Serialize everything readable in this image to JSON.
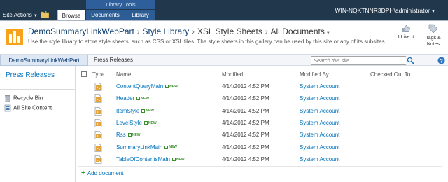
{
  "ribbon": {
    "site_actions": "Site Actions",
    "contextual_group": "Library Tools",
    "tabs": [
      {
        "label": "Browse"
      },
      {
        "label": "Documents"
      },
      {
        "label": "Library"
      }
    ],
    "user": "WIN-NQKTNNR3DPH\\administrator"
  },
  "title_area": {
    "breadcrumb": [
      "DemoSummaryLinkWebPart",
      "Style Library",
      "XSL Style Sheets",
      "All Documents"
    ],
    "description": "Use the style library to store style sheets, such as CSS or XSL files. The style sheets in this gallery can be used by this site or any of its subsites.",
    "i_like_it": "I Like It",
    "tags_notes": [
      "Tags &",
      "Notes"
    ]
  },
  "top_nav": {
    "items": [
      "DemoSummaryLinkWebPart",
      "Press Releases"
    ],
    "search_placeholder": "Search this site..."
  },
  "quick_launch": {
    "heading": "Press Releases",
    "recycle_bin": "Recycle Bin",
    "all_site_content": "All Site Content"
  },
  "list": {
    "columns": [
      "Type",
      "Name",
      "Modified",
      "Modified By",
      "Checked Out To"
    ],
    "rows": [
      {
        "name": "ContentQueryMain",
        "new": "NEW",
        "modified": "4/14/2012 4:52 PM",
        "modified_by": "System Account"
      },
      {
        "name": "Header",
        "new": "NEW",
        "modified": "4/14/2012 4:52 PM",
        "modified_by": "System Account"
      },
      {
        "name": "ItemStyle",
        "new": "NEW",
        "modified": "4/14/2012 4:52 PM",
        "modified_by": "System Account"
      },
      {
        "name": "LevelStyle",
        "new": "NEW",
        "modified": "4/14/2012 4:52 PM",
        "modified_by": "System Account"
      },
      {
        "name": "Rss",
        "new": "NEW",
        "modified": "4/14/2012 4:52 PM",
        "modified_by": "System Account"
      },
      {
        "name": "SummaryLinkMain",
        "new": "NEW",
        "modified": "4/14/2012 4:52 PM",
        "modified_by": "System Account"
      },
      {
        "name": "TableOfContentsMain",
        "new": "NEW",
        "modified": "4/14/2012 4:52 PM",
        "modified_by": "System Account"
      }
    ],
    "add_document": "Add document"
  },
  "colors": {
    "ribbon_bg": "#21374c",
    "contextual_tab": "#2d5d95",
    "link": "#0072bc",
    "new_badge": "#3a8f2a"
  },
  "icons": [
    "folder-nav-icon",
    "site-logo-icon",
    "thumbs-up-icon",
    "tag-icon",
    "search-icon",
    "help-icon",
    "recycle-bin-icon",
    "site-content-icon",
    "xsl-document-icon",
    "add-icon"
  ]
}
